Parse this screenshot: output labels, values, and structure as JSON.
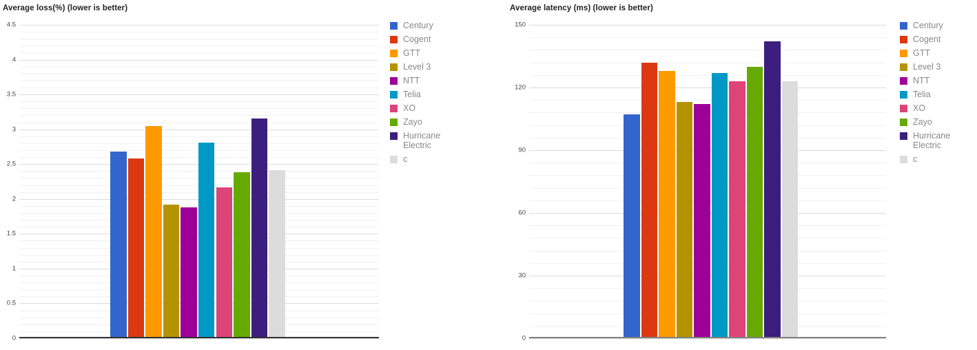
{
  "series_names": [
    "Century",
    "Cogent",
    "GTT",
    "Level 3",
    "NTT",
    "Telia",
    "XO",
    "Zayo",
    "Hurricane Electric",
    "c"
  ],
  "colors": {
    "Century": "#3366cc",
    "Cogent": "#dc3912",
    "GTT": "#ff9900",
    "Level 3": "#b49300",
    "NTT": "#9c0099",
    "Telia": "#0099c6",
    "XO": "#dd4477",
    "Zayo": "#66aa00",
    "Hurricane Electric": "#3b1e7e",
    "c": "#dcdcdc"
  },
  "legend": {
    "items": [
      {
        "label": "Century",
        "color": "#3366cc"
      },
      {
        "label": "Cogent",
        "color": "#dc3912"
      },
      {
        "label": "GTT",
        "color": "#ff9900"
      },
      {
        "label": "Level 3",
        "color": "#b49300"
      },
      {
        "label": "NTT",
        "color": "#9c0099"
      },
      {
        "label": "Telia",
        "color": "#0099c6"
      },
      {
        "label": "XO",
        "color": "#dd4477"
      },
      {
        "label": "Zayo",
        "color": "#66aa00"
      },
      {
        "label": "Hurricane\nElectric",
        "color": "#3b1e7e"
      },
      {
        "label": "c",
        "color": "#dcdcdc"
      }
    ]
  },
  "chart_data": [
    {
      "id": "loss",
      "type": "bar",
      "title": "Average loss(%) (lower is better)",
      "xlabel": "",
      "ylabel": "",
      "ylim": [
        0,
        4.5
      ],
      "ytick_labels": [
        "4.5",
        "4",
        "3.5",
        "3",
        "2.5",
        "2",
        "1.5",
        "1",
        "0.5",
        "0"
      ],
      "ytick_values": [
        4.5,
        4,
        3.5,
        3,
        2.5,
        2,
        1.5,
        1,
        0.5,
        0
      ],
      "major_step": 0.5,
      "minor_step": 0.1,
      "grid": true,
      "legend_position": "right",
      "categories": [
        "Century",
        "Cogent",
        "GTT",
        "Level 3",
        "NTT",
        "Telia",
        "XO",
        "Zayo",
        "Hurricane Electric",
        "c"
      ],
      "values": [
        2.68,
        2.58,
        3.05,
        1.92,
        1.88,
        2.81,
        2.17,
        2.38,
        3.16,
        2.41
      ]
    },
    {
      "id": "latency",
      "type": "bar",
      "title": "Average latency (ms) (lower is better)",
      "xlabel": "",
      "ylabel": "",
      "ylim": [
        0,
        150
      ],
      "ytick_labels": [
        "150",
        "120",
        "90",
        "60",
        "30",
        "0"
      ],
      "ytick_values": [
        150,
        120,
        90,
        60,
        30,
        0
      ],
      "major_step": 30,
      "minor_step": 6,
      "grid": true,
      "legend_position": "right",
      "categories": [
        "Century",
        "Cogent",
        "GTT",
        "Level 3",
        "NTT",
        "Telia",
        "XO",
        "Zayo",
        "Hurricane Electric",
        "c"
      ],
      "values": [
        107,
        132,
        128,
        113,
        112,
        127,
        123,
        130,
        142,
        123
      ]
    }
  ]
}
